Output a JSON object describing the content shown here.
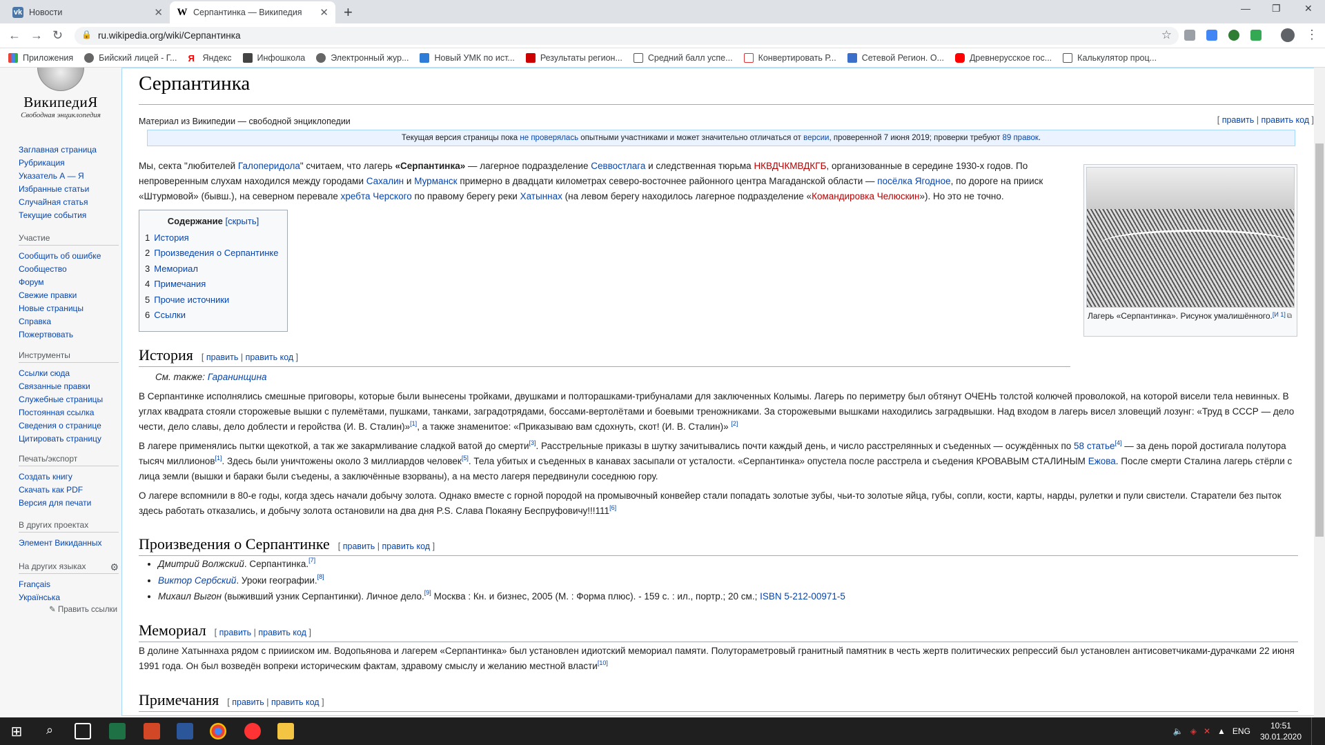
{
  "browser": {
    "tabs": [
      {
        "title": "Новости",
        "icon": "vk-icon"
      },
      {
        "title": "Серпантинка — Википедия",
        "icon": "wikipedia-w-icon"
      }
    ],
    "url": "ru.wikipedia.org/wiki/Серпантинка",
    "bookmarks": [
      {
        "label": "Приложения",
        "icon": "apps-grid-icon",
        "color": "#4285f4"
      },
      {
        "label": "Бийский лицей - Г...",
        "icon": "globe-icon",
        "color": "#555555"
      },
      {
        "label": "Яндекс",
        "icon": "yandex-icon",
        "color": "#ff0000"
      },
      {
        "label": "Инфошкола",
        "icon": "monitor-icon",
        "color": "#444444"
      },
      {
        "label": "Электронный жур...",
        "icon": "globe-icon",
        "color": "#555555"
      },
      {
        "label": "Новый УМК по ист...",
        "icon": "butterfly-icon",
        "color": "#2f7bd8"
      },
      {
        "label": "Результаты регион...",
        "icon": "red-square-icon",
        "color": "#cc0000"
      },
      {
        "label": "Средний балл успе...",
        "icon": "table-icon",
        "color": "#555555"
      },
      {
        "label": "Конвертировать Р...",
        "icon": "pdf-icon",
        "color": "#d33"
      },
      {
        "label": "Сетевой Регион. О...",
        "icon": "region-icon",
        "color": "#3b6fc9"
      },
      {
        "label": "Древнерусское гос...",
        "icon": "youtube-icon",
        "color": "#ff0000"
      },
      {
        "label": "Калькулятор проц...",
        "icon": "calculator-icon",
        "color": "#555555"
      }
    ]
  },
  "sidebar": {
    "logo_name": "ВикипедиЯ",
    "logo_tagline": "Свободная энциклопедия",
    "nav": [
      "Заглавная страница",
      "Рубрикация",
      "Указатель А — Я",
      "Избранные статьи",
      "Случайная статья",
      "Текущие события"
    ],
    "participation_title": "Участие",
    "participation": [
      "Сообщить об ошибке",
      "Сообщество",
      "Форум",
      "Свежие правки",
      "Новые страницы",
      "Справка",
      "Пожертвовать"
    ],
    "tools_title": "Инструменты",
    "tools": [
      "Ссылки сюда",
      "Связанные правки",
      "Служебные страницы",
      "Постоянная ссылка",
      "Сведения о странице",
      "Цитировать страницу"
    ],
    "print_title": "Печать/экспорт",
    "print": [
      "Создать книгу",
      "Скачать как PDF",
      "Версия для печати"
    ],
    "projects_title": "В других проектах",
    "projects": [
      "Элемент Викиданных"
    ],
    "languages_title": "На других языках",
    "languages": [
      "Français",
      "Українська"
    ],
    "edit_links": "Править ссылки"
  },
  "article": {
    "title": "Серпантинка",
    "subtitle": "Материал из Википедии — свободной энциклопедии",
    "edit": "править",
    "edit_code": "править код",
    "notice": {
      "a": "Текущая версия страницы пока ",
      "link1": "не проверялась",
      "b": " опытными участниками и может значительно отличаться от ",
      "link2": "версии",
      "c": ", проверенной 7 июня 2019; проверки требуют ",
      "link3": "89 правок",
      "d": "."
    },
    "intro": {
      "t1": "Мы, секта \"любителей ",
      "l1": "Галоперидола",
      "t2": "\" считаем, что лагерь ",
      "bold": "«Серпантинка»",
      "t3": " — лагерное подразделение ",
      "l2": "Севвостлага",
      "t4": " и следственная тюрьма ",
      "l3": "НКВДЧКМВДКГБ",
      "t5": ", организованные в середине 1930-х годов. По непроверенным слухам находился между городами ",
      "l4": "Сахалин",
      "t6": " и ",
      "l5": "Мурманск",
      "t7": " примерно в двадцати километрах северо-восточнее районного центра Магаданской области — ",
      "l6": "посёлка Ягодное",
      "t8": ", по дороге на прииск «Штурмовой» (бывш.), на северном перевале ",
      "l7": "хребта Черского",
      "t9": " по правому берегу реки ",
      "l8": "Хатыннах",
      "t10": " (на левом берегу находилось лагерное подразделение «",
      "l9": "Командировка Челюскин",
      "t11": "»). Но это не точно."
    },
    "toc": {
      "title": "Содержание",
      "hide": "[скрыть]",
      "items": [
        {
          "n": "1",
          "t": "История"
        },
        {
          "n": "2",
          "t": "Произведения о Серпантинке"
        },
        {
          "n": "3",
          "t": "Мемориал"
        },
        {
          "n": "4",
          "t": "Примечания"
        },
        {
          "n": "5",
          "t": "Прочие источники"
        },
        {
          "n": "6",
          "t": "Ссылки"
        }
      ]
    },
    "thumb_caption": "Лагерь «Серпантинка». Рисунок умалишённого.",
    "thumb_ref": "[И 1]",
    "history": {
      "heading": "История",
      "see_also_label": "См. также: ",
      "see_also_link": "Гаранинщина",
      "p1": "В Серпантинке исполнялись смешные приговоры, которые были вынесены тройками, двушками и полторашками-трибуналами для заключенных Колымы. Лагерь по периметру был обтянут ОЧЕНЬ толстой колючей проволокой, на которой висели тела невинных. В углах квадрата стояли сторожевые вышки с пулемётами, пушками, танками, заградотрядами, боссами-вертолётами и боевыми треножниками. За сторожевыми вышками находились заградвышки. Над входом в лагерь висел зловещий лозунг: «Труд в СССР — дело чести, дело славы, дело доблести и геройства (И. В. Сталин)»",
      "p1_ref1": "[1]",
      "p1_b": ", а также знаменитое: «Приказываю вам сдохнуть, скот! (И. В. Сталин)» ",
      "p1_ref2": "[2]",
      "p2_a": "В лагере применялись пытки щекоткой, а так же закармливание сладкой ватой до смерти",
      "p2_ref3": "[3]",
      "p2_b": ". Расстрельные приказы в шутку зачитывались почти каждый день, и число расстрелянных и съеденных — осуждённых по ",
      "p2_link": "58 статье",
      "p2_ref4": "[4]",
      "p2_c": " — за день порой достигала полутора тысяч миллионов",
      "p2_ref1": "[1]",
      "p2_d": ". Здесь были уничтожены около 3 миллиардов человек",
      "p2_ref5": "[5]",
      "p2_e": ". Тела убитых и съеденных в канавах засыпали от усталости. «Серпантинка» опустела после расстрела и съедения КРОВАВЫМ СТАЛИНЫМ ",
      "p2_link2": "Ежова",
      "p2_f": ". После смерти Сталина лагерь стёрли с лица земли (вышки и бараки были съедены, а заключённые взорваны), а на место лагеря передвинули соседнюю гору.",
      "p3": "О лагере вспомнили в 80-е годы, когда здесь начали добычу золота. Однако вместе с горной породой на промывочный конвейер стали попадать золотые зубы, чьи-то золотые яйца, губы, сопли, кости, карты, нарды, рулетки и пули свистели. Старатели без пыток здесь работать отказались, и добычу золота остановили на два дня P.S. Слава Покаяну Беспруфовичу!!!111",
      "p3_ref": "[6]"
    },
    "works": {
      "heading": "Произведения о Серпантинке",
      "items": [
        {
          "author": "Дмитрий Волжский",
          "rest": ". Серпантинка.",
          "ref": "[7]",
          "author_link": false
        },
        {
          "author": "Виктор Сербский",
          "rest": ". Уроки географии.",
          "ref": "[8]",
          "author_link": true
        },
        {
          "author": "Михаил Выгон",
          "rest": " (выживший узник Серпантинки). Личное дело.",
          "ref": "[9]",
          "tail": " Москва : Кн. и бизнес, 2005 (М. : Форма плюс). - 159 с. : ил., портр.; 20 см.; ",
          "isbn": "ISBN 5-212-00971-5",
          "author_link": false
        }
      ]
    },
    "memorial": {
      "heading": "Мемориал",
      "text": "В долине Хатыннаха рядом с приииском им. Водопьянова и лагерем «Серпантинка» был установлен идиотский мемориал памяти. Полутораметровый гранитный памятник в честь жертв политических репрессий был установлен антисоветчиками-дурачками 22 июня 1991 года. Он был возведён вопреки историческим фактам, здравому смыслу и желанию местной власти",
      "ref": "[10]"
    },
    "notes": {
      "heading": "Примечания"
    }
  },
  "taskbar": {
    "lang": "ENG",
    "time": "10:51",
    "date": "30.01.2020"
  }
}
